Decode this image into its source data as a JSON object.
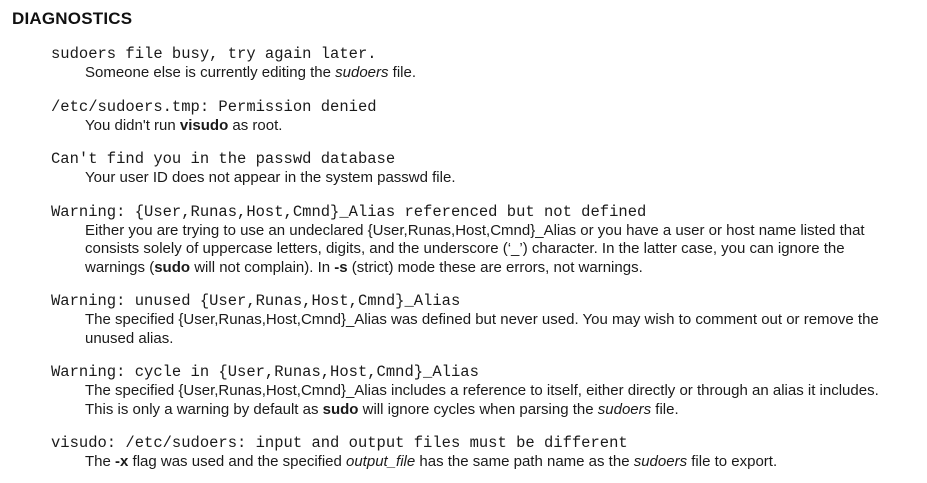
{
  "section": {
    "heading": "DIAGNOSTICS"
  },
  "entries": [
    {
      "term": "sudoers file busy, try again later.",
      "desc": [
        {
          "t": "Someone else is currently editing the "
        },
        {
          "t": "sudoers",
          "i": true
        },
        {
          "t": " file."
        }
      ]
    },
    {
      "term": "/etc/sudoers.tmp: Permission denied",
      "desc": [
        {
          "t": "You didn't run "
        },
        {
          "t": "visudo",
          "b": true
        },
        {
          "t": " as root."
        }
      ]
    },
    {
      "term": "Can't find you in the passwd database",
      "desc": [
        {
          "t": "Your user ID does not appear in the system passwd file."
        }
      ]
    },
    {
      "term": "Warning: {User,Runas,Host,Cmnd}_Alias referenced but not defined",
      "desc": [
        {
          "t": "Either you are trying to use an undeclared {User,Runas,Host,Cmnd}_Alias or you have a user or host name listed that consists solely of uppercase letters, digits, and the underscore (‘_’) character. In the latter case, you can ignore the warnings ("
        },
        {
          "t": "sudo",
          "b": true
        },
        {
          "t": " will not complain). In "
        },
        {
          "t": "-s",
          "b": true
        },
        {
          "t": " (strict) mode these are errors, not warnings."
        }
      ]
    },
    {
      "term": "Warning: unused {User,Runas,Host,Cmnd}_Alias",
      "desc": [
        {
          "t": "The specified {User,Runas,Host,Cmnd}_Alias was defined but never used. You may wish to comment out or remove the unused alias."
        }
      ]
    },
    {
      "term": "Warning: cycle in {User,Runas,Host,Cmnd}_Alias",
      "desc": [
        {
          "t": "The specified {User,Runas,Host,Cmnd}_Alias includes a reference to itself, either directly or through an alias it includes. This is only a warning by default as "
        },
        {
          "t": "sudo",
          "b": true
        },
        {
          "t": " will ignore cycles when parsing the "
        },
        {
          "t": "sudoers",
          "i": true
        },
        {
          "t": " file."
        }
      ]
    },
    {
      "term": "visudo: /etc/sudoers: input and output files must be different",
      "desc": [
        {
          "t": "The "
        },
        {
          "t": "-x",
          "b": true
        },
        {
          "t": " flag was used and the specified "
        },
        {
          "t": "output_file",
          "i": true
        },
        {
          "t": " has the same path name as the "
        },
        {
          "t": "sudoers",
          "i": true
        },
        {
          "t": " file to export."
        }
      ]
    }
  ]
}
